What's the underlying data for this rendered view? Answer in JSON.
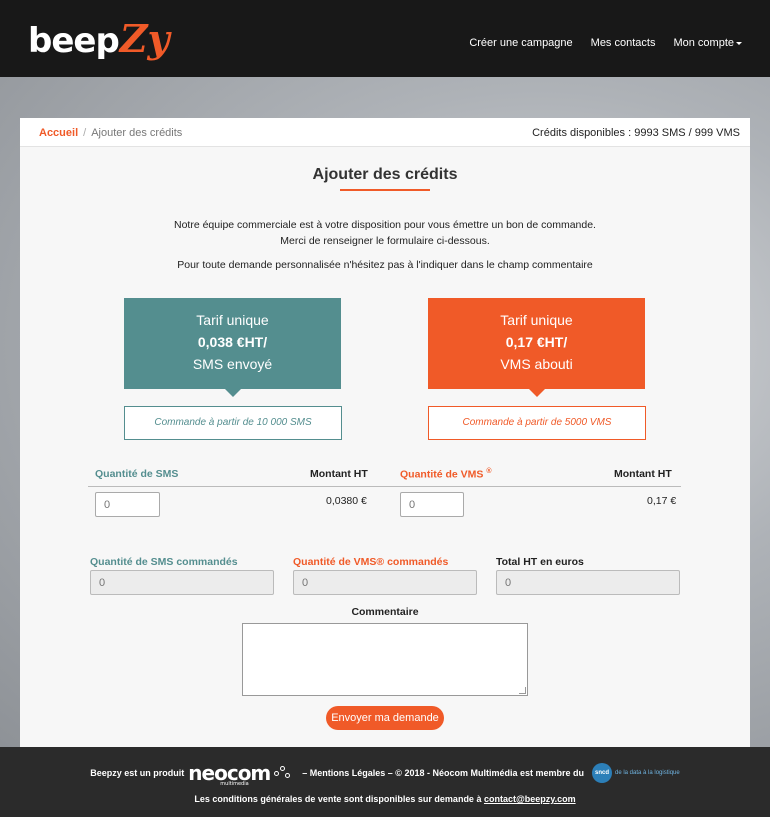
{
  "brand": {
    "logo_part1": "beep",
    "logo_part2": "Zy"
  },
  "nav": {
    "create_campaign": "Créer une campagne",
    "my_contacts": "Mes contacts",
    "my_account": "Mon compte"
  },
  "breadcrumb": {
    "home": "Accueil",
    "separator": "/",
    "current": "Ajouter des crédits"
  },
  "credits": "Crédits disponibles : 9993 SMS / 999 VMS",
  "page": {
    "title": "Ajouter des crédits",
    "intro_line1": "Notre équipe commerciale est à votre disposition pour vous émettre un bon de commande.",
    "intro_line2": "Merci de renseigner le formulaire ci-dessous.",
    "intro_line3": "Pour toute demande personnalisée n'hésitez pas à l'indiquer dans le champ commentaire"
  },
  "offers": {
    "sms": {
      "line1": "Tarif unique",
      "price": "0,038 €HT/",
      "line3": "SMS envoyé",
      "min": "Commande à partir de 10 000 SMS"
    },
    "vms": {
      "line1": "Tarif unique",
      "price": "0,17 €HT/",
      "line3": "VMS abouti",
      "min": "Commande à partir de 5000 VMS"
    }
  },
  "sms_calc": {
    "qty_label": "Quantité de SMS",
    "amount_label": "Montant HT",
    "qty_placeholder": "0",
    "unit_price": "0,0380 €"
  },
  "vms_calc": {
    "qty_label": "Quantité de VMS",
    "qty_sup": "®",
    "amount_label": "Montant HT",
    "qty_placeholder": "0",
    "unit_price": "0,17 €"
  },
  "totals": {
    "sms_ordered_label": "Quantité de SMS commandés",
    "vms_ordered_label": "Quantité de VMS® commandés",
    "total_label": "Total HT en euros",
    "sms_ordered_placeholder": "0",
    "vms_ordered_placeholder": "0",
    "total_placeholder": "0"
  },
  "comment_label": "Commentaire",
  "submit_label": "Envoyer ma demande",
  "footer": {
    "product_of": "Beepzy est un produit",
    "neocom": "neocom",
    "neocom_sub": "multimedia",
    "legal": "– Mentions Légales – © 2018 - Néocom Multimédia est membre du",
    "sncd_badge": "sncd",
    "sncd_tag": "de la data à la logistique",
    "cgv_text": "Les conditions générales de vente sont disponibles sur demande à",
    "contact_email": "contact@beepzy.com"
  },
  "colors": {
    "accent": "#f05a28",
    "teal": "#548e8f",
    "header_bg": "#181818",
    "footer_bg": "#2b2b2b"
  }
}
